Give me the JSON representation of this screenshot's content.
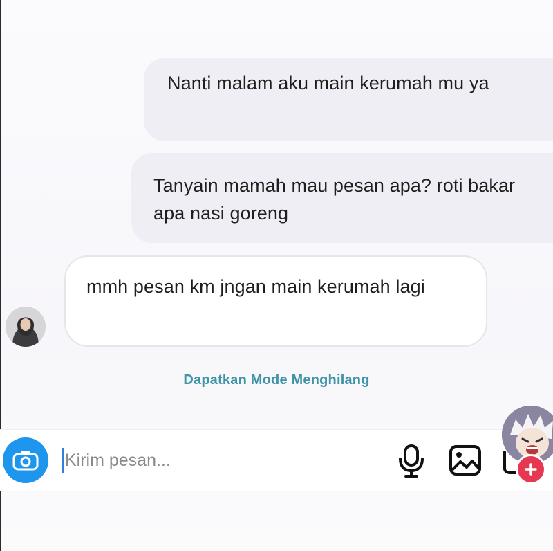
{
  "messages": [
    {
      "side": "outgoing",
      "text": "Nanti malam aku main kerumah mu ya"
    },
    {
      "side": "outgoing",
      "text": "Tanyain mamah mau pesan apa? roti bakar apa nasi goreng"
    },
    {
      "side": "incoming",
      "text": "mmh pesan km jngan main kerumah lagi"
    }
  ],
  "vanish_mode_link": "Dapatkan Mode Menghilang",
  "composer": {
    "placeholder": "Kirim pesan...",
    "value": "",
    "icons": {
      "camera": "camera-icon",
      "mic": "microphone-icon",
      "gallery": "image-icon",
      "sticker": "sticker-icon",
      "add": "plus-icon"
    }
  },
  "colors": {
    "outgoing_bubble": "#efeef4",
    "incoming_border": "#e6e5ea",
    "accent_blue": "#1f96ee",
    "link_teal": "#3f93a6",
    "badge_red": "#e63850"
  }
}
